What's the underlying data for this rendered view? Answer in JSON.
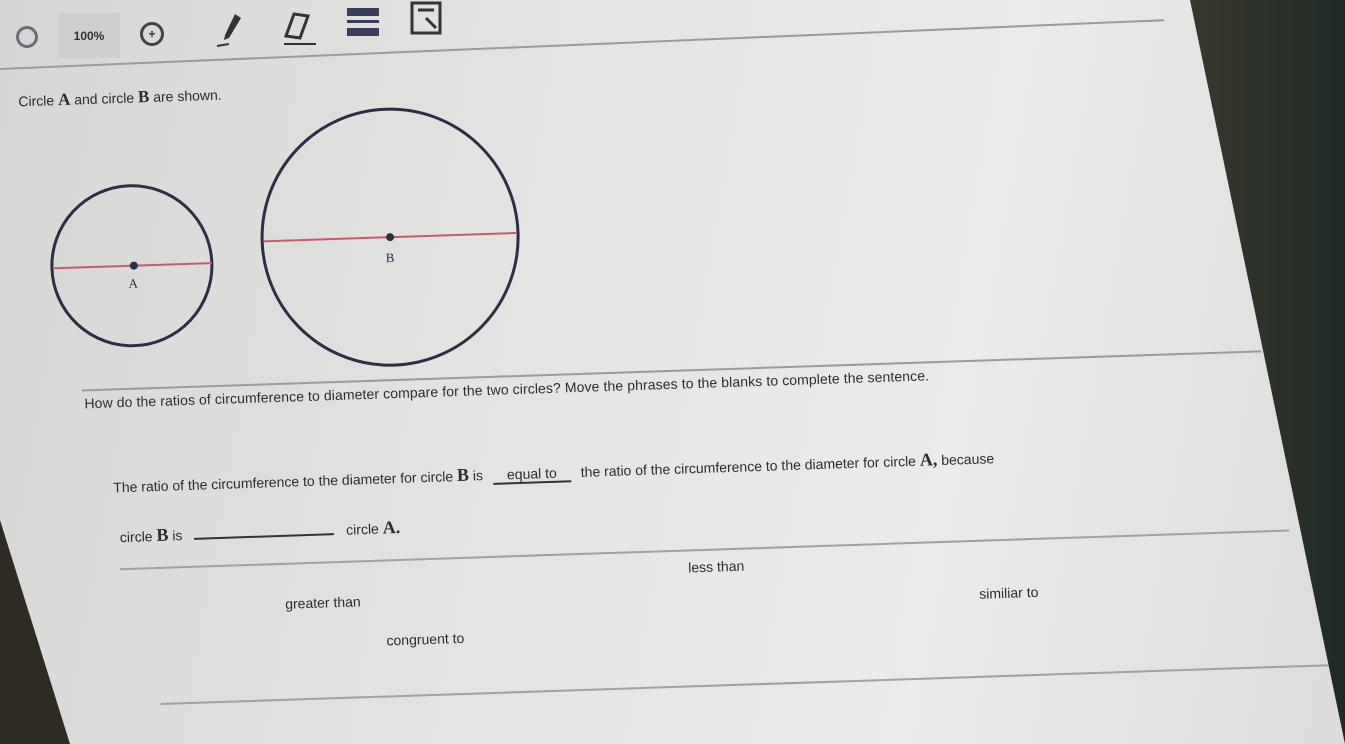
{
  "toolbar": {
    "zoom_label": "100%",
    "icons": [
      "search-icon",
      "zoom-in-icon",
      "pen-icon",
      "eraser-icon",
      "line-reader-icon",
      "calculator-icon"
    ]
  },
  "question": {
    "prompt_pre": "Circle",
    "prompt_a": "A",
    "prompt_mid": "and circle",
    "prompt_b": "B",
    "prompt_post": "are shown.",
    "circle_a_label": "A",
    "circle_b_label": "B",
    "instruction": "How do the ratios of circumference to diameter compare for the two circles? Move the phrases to the blanks to complete the sentence.",
    "sentence_part1": "The ratio of the circumference to the diameter for circle",
    "sentence_b": "B",
    "sentence_is": "is",
    "blank1_value": "equal to",
    "sentence_part2": "the ratio of the circumference to the diameter for circle",
    "sentence_a": "A,",
    "sentence_part3": "because",
    "line2_pre": "circle",
    "line2_b": "B",
    "line2_is": "is",
    "blank2_value": "",
    "line2_post": "circle",
    "line2_a": "A."
  },
  "phrases": {
    "less_than": "less than",
    "greater_than": "greater than",
    "similar_to": "similiar to",
    "congruent_to": "congruent to"
  },
  "colors": {
    "diameter_line": "#c85a6a",
    "circle_stroke": "#2a2f44"
  }
}
